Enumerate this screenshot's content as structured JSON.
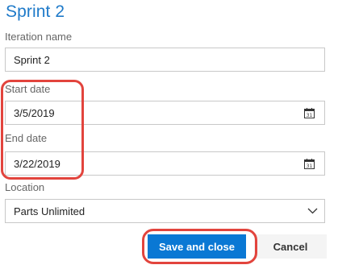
{
  "dialog": {
    "title": "Sprint 2"
  },
  "iteration_name": {
    "label": "Iteration name",
    "value": "Sprint 2"
  },
  "start_date": {
    "label": "Start date",
    "value": "3/5/2019",
    "icon": "calendar-icon"
  },
  "end_date": {
    "label": "End date",
    "value": "3/22/2019",
    "icon": "calendar-icon"
  },
  "location": {
    "label": "Location",
    "value": "Parts Unlimited",
    "icon": "chevron-down-icon"
  },
  "actions": {
    "save_label": "Save and close",
    "cancel_label": "Cancel"
  },
  "colors": {
    "title": "#1f7ac9",
    "primary_button": "#0a78d4",
    "annotation": "#e2443d"
  }
}
